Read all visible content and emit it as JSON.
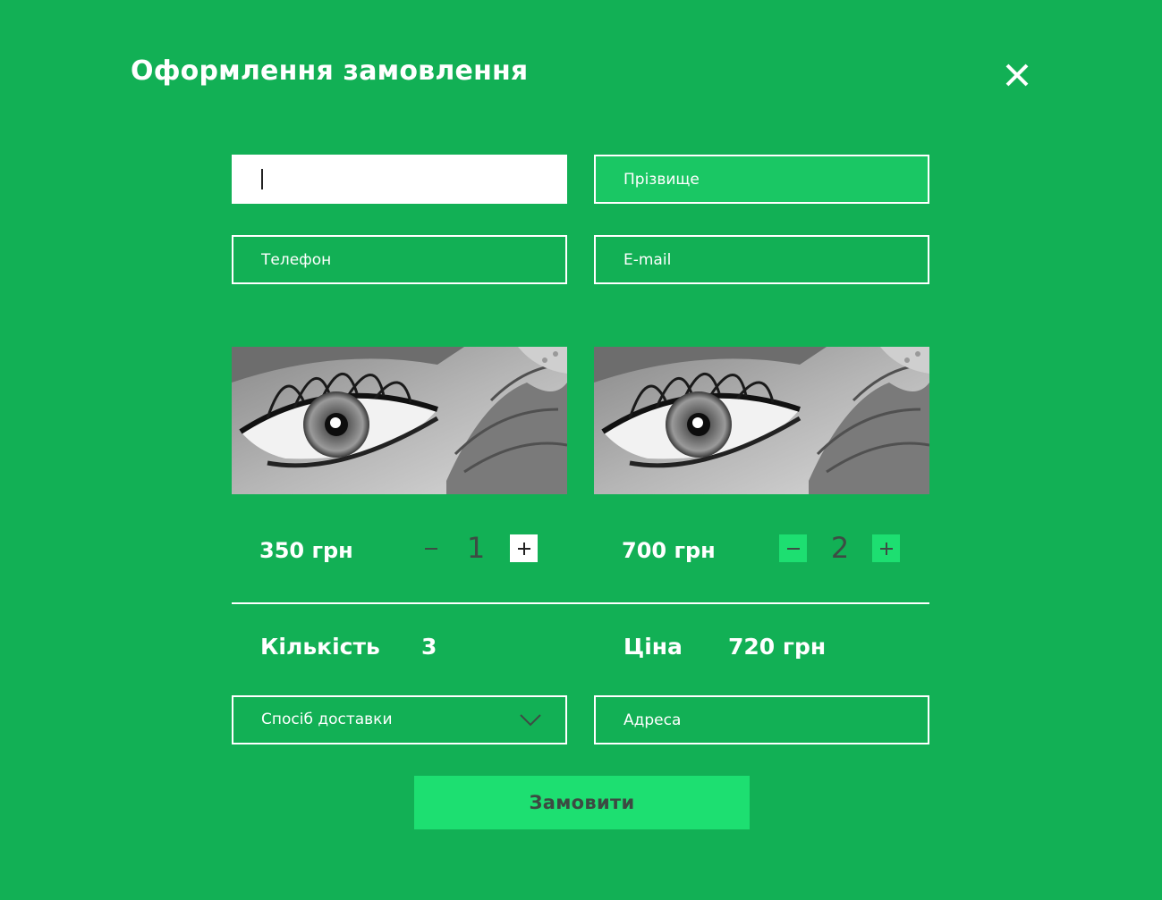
{
  "modal": {
    "title": "Оформлення замовлення"
  },
  "form": {
    "first_name": {
      "value": "",
      "placeholder": ""
    },
    "last_name": {
      "placeholder": "Прізвище"
    },
    "phone": {
      "placeholder": "Телефон"
    },
    "email": {
      "placeholder": "E-mail"
    },
    "delivery": {
      "label": "Спосіб доставки"
    },
    "address": {
      "placeholder": "Адреса"
    }
  },
  "products": [
    {
      "image": "eye-with-flower-photo",
      "price": "350 грн",
      "quantity": "1"
    },
    {
      "image": "eye-with-flower-photo",
      "price": "700 грн",
      "quantity": "2"
    }
  ],
  "summary": {
    "quantity_label": "Кількість",
    "quantity_value": "3",
    "price_label": "Ціна",
    "price_value": "720 грн"
  },
  "submit_label": "Замовити",
  "colors": {
    "background": "#12b055",
    "accent": "#1ddf71",
    "hover_field": "#1ac764",
    "text_dark": "#3c4a42"
  },
  "icons": {
    "close": "close-icon",
    "minus": "minus-icon",
    "plus": "plus-icon",
    "dropdown": "chevron-down-icon"
  }
}
